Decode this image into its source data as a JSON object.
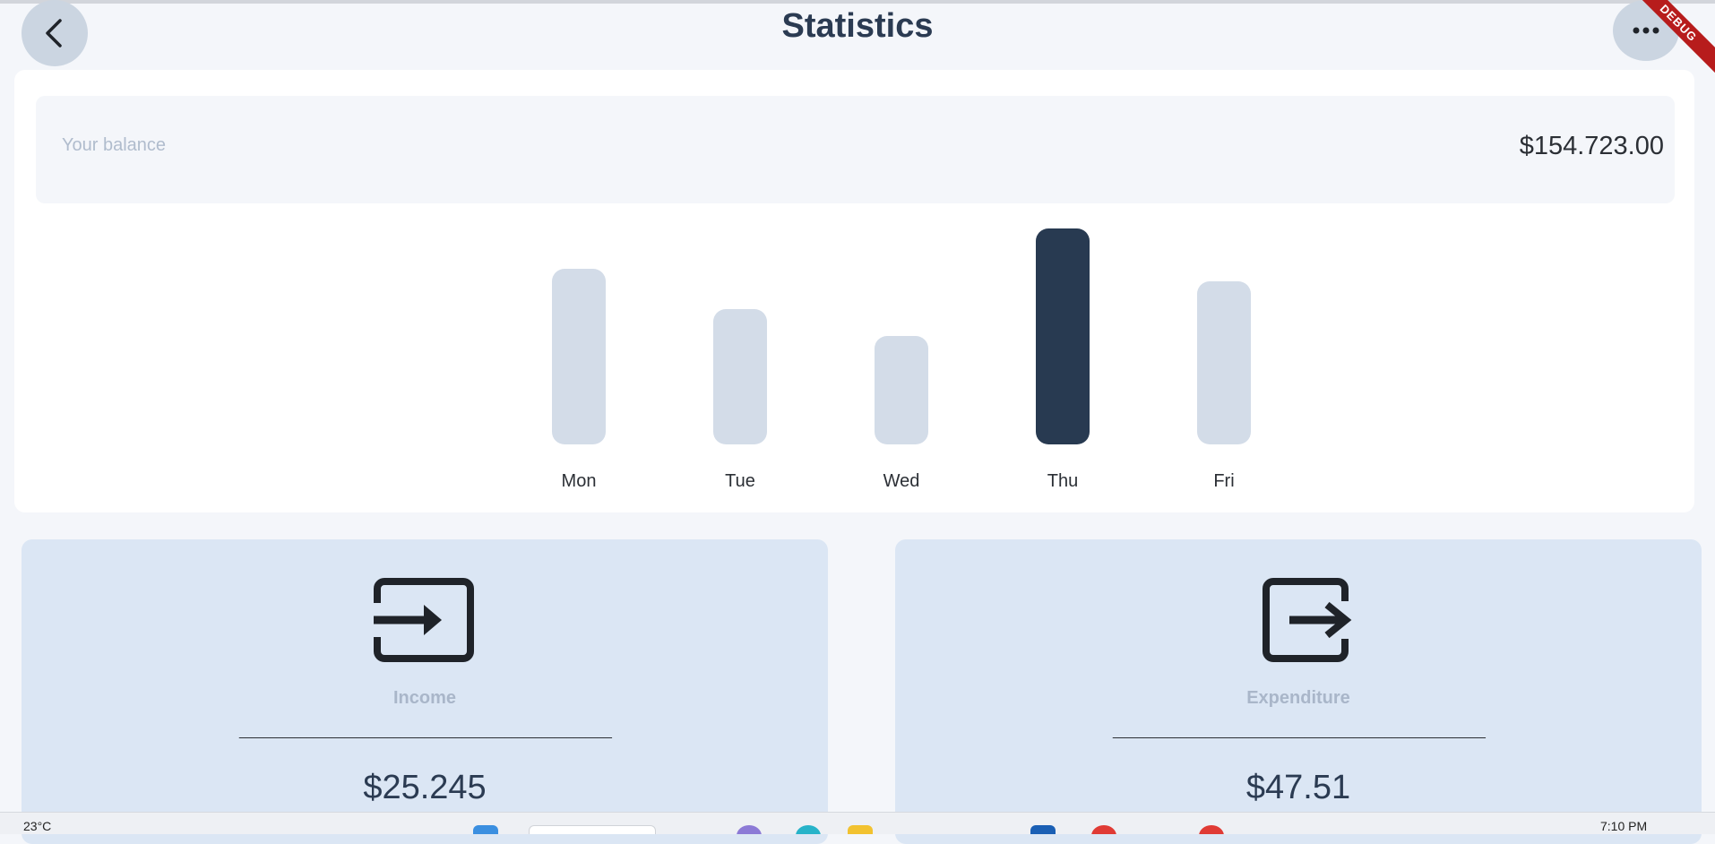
{
  "header": {
    "title": "Statistics",
    "back_icon": "chevron-left-icon",
    "more_icon": "more-horizontal-icon",
    "debug_banner": "DEBUG"
  },
  "balance": {
    "label": "Your balance",
    "value": "$154.723.00"
  },
  "chart_data": {
    "type": "bar",
    "categories": [
      "Mon",
      "Tue",
      "Wed",
      "Thu",
      "Fri"
    ],
    "values": [
      196,
      151,
      121,
      241,
      182
    ],
    "highlight": "Thu",
    "colors": {
      "default": "#d3dce8",
      "highlight": "#283a51"
    }
  },
  "income": {
    "label": "Income",
    "rule": "____________________________________________________________",
    "amount": "$25.245",
    "icon": "input-icon"
  },
  "expenditure": {
    "label": "Expenditure",
    "rule": "____________________________________________________________",
    "amount": "$47.51",
    "icon": "output-icon"
  },
  "taskbar": {
    "weather": "23°C",
    "time": "7:10 PM"
  }
}
